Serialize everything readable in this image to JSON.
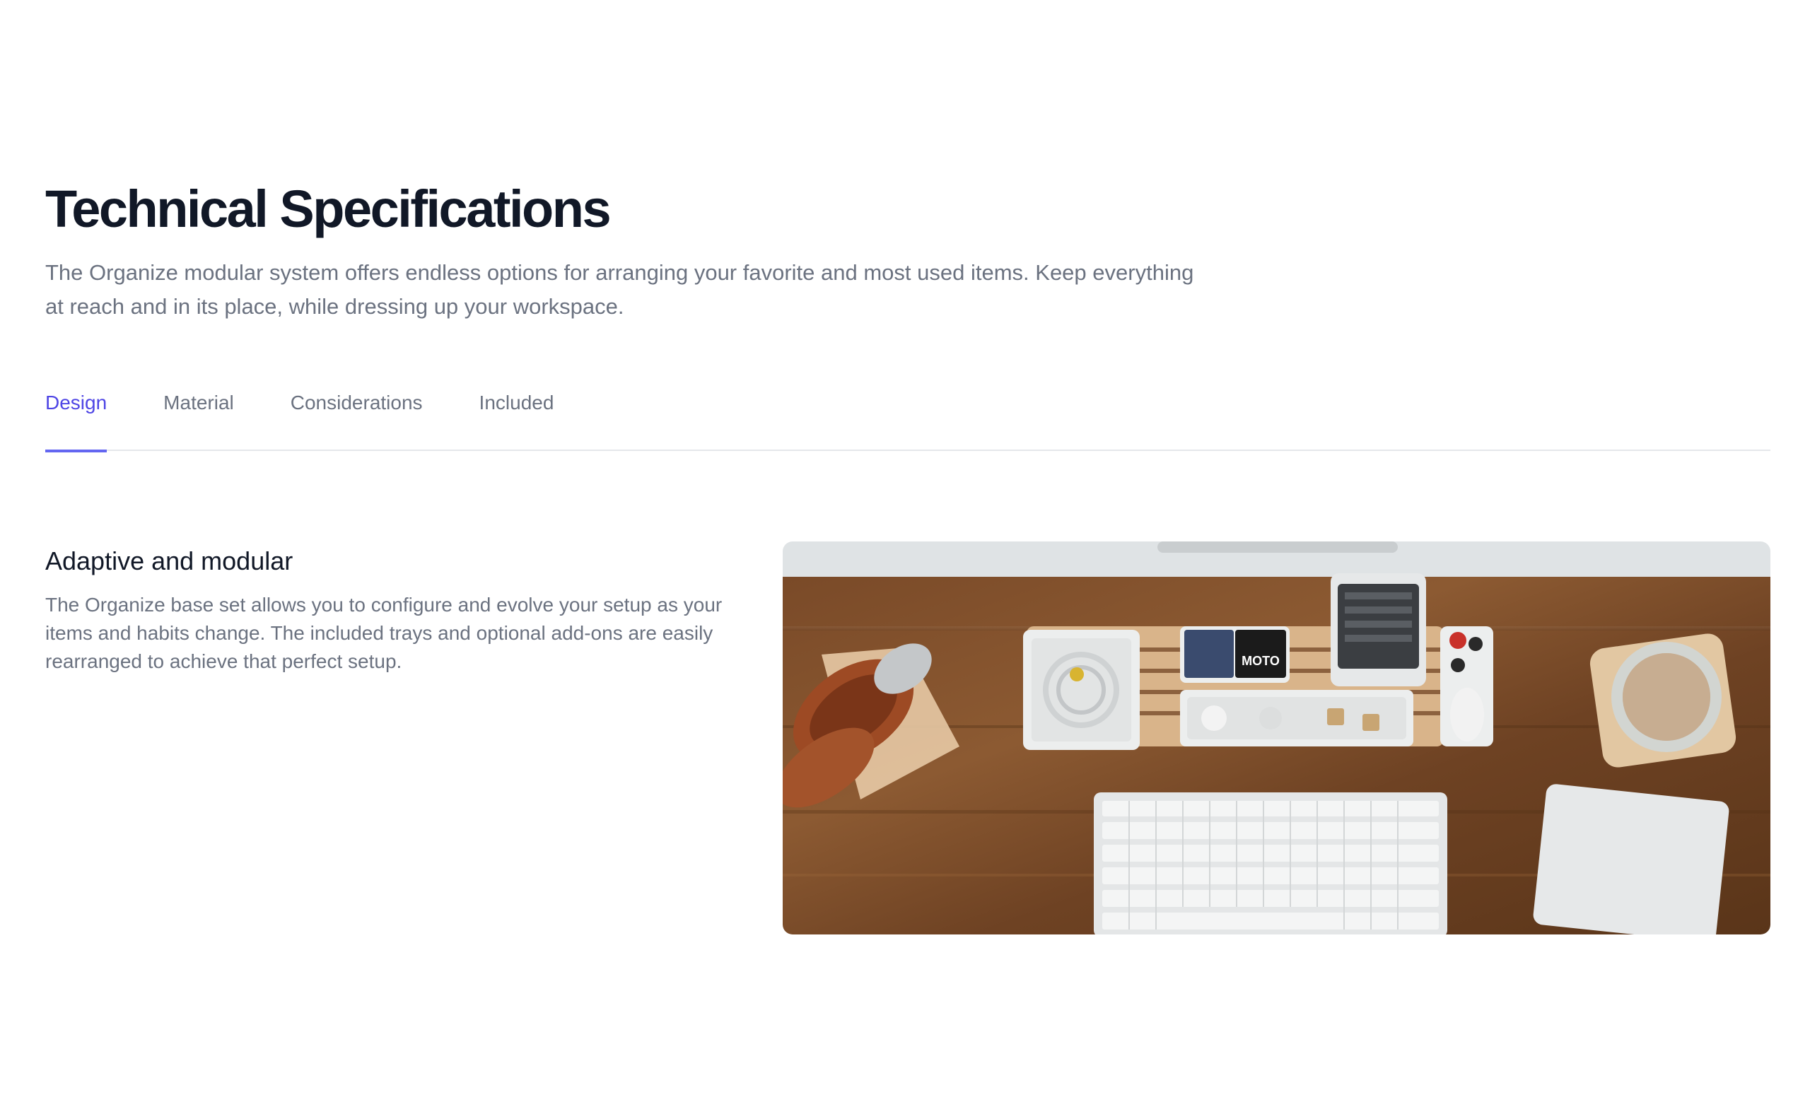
{
  "header": {
    "title": "Technical Specifications",
    "subtitle": "The Organize modular system offers endless options for arranging your favorite and most used items. Keep everything at reach and in its place, while dressing up your workspace."
  },
  "tabs": [
    {
      "label": "Design",
      "active": true
    },
    {
      "label": "Material",
      "active": false
    },
    {
      "label": "Considerations",
      "active": false
    },
    {
      "label": "Included",
      "active": false
    }
  ],
  "panel": {
    "heading": "Adaptive and modular",
    "body": "The Organize base set allows you to configure and evolve your setup as your items and habits change. The included trays and optional add-ons are easily rearranged to achieve that perfect setup.",
    "image_alt": "Walnut desk with organizer trays, keyboard, headphones, phone and glass",
    "image_logo_text": "MOTO"
  },
  "colors": {
    "title": "#111827",
    "muted": "#6b7280",
    "accent": "#4f46e5",
    "accent_underline": "#6366f1",
    "divider": "#e5e7eb"
  }
}
